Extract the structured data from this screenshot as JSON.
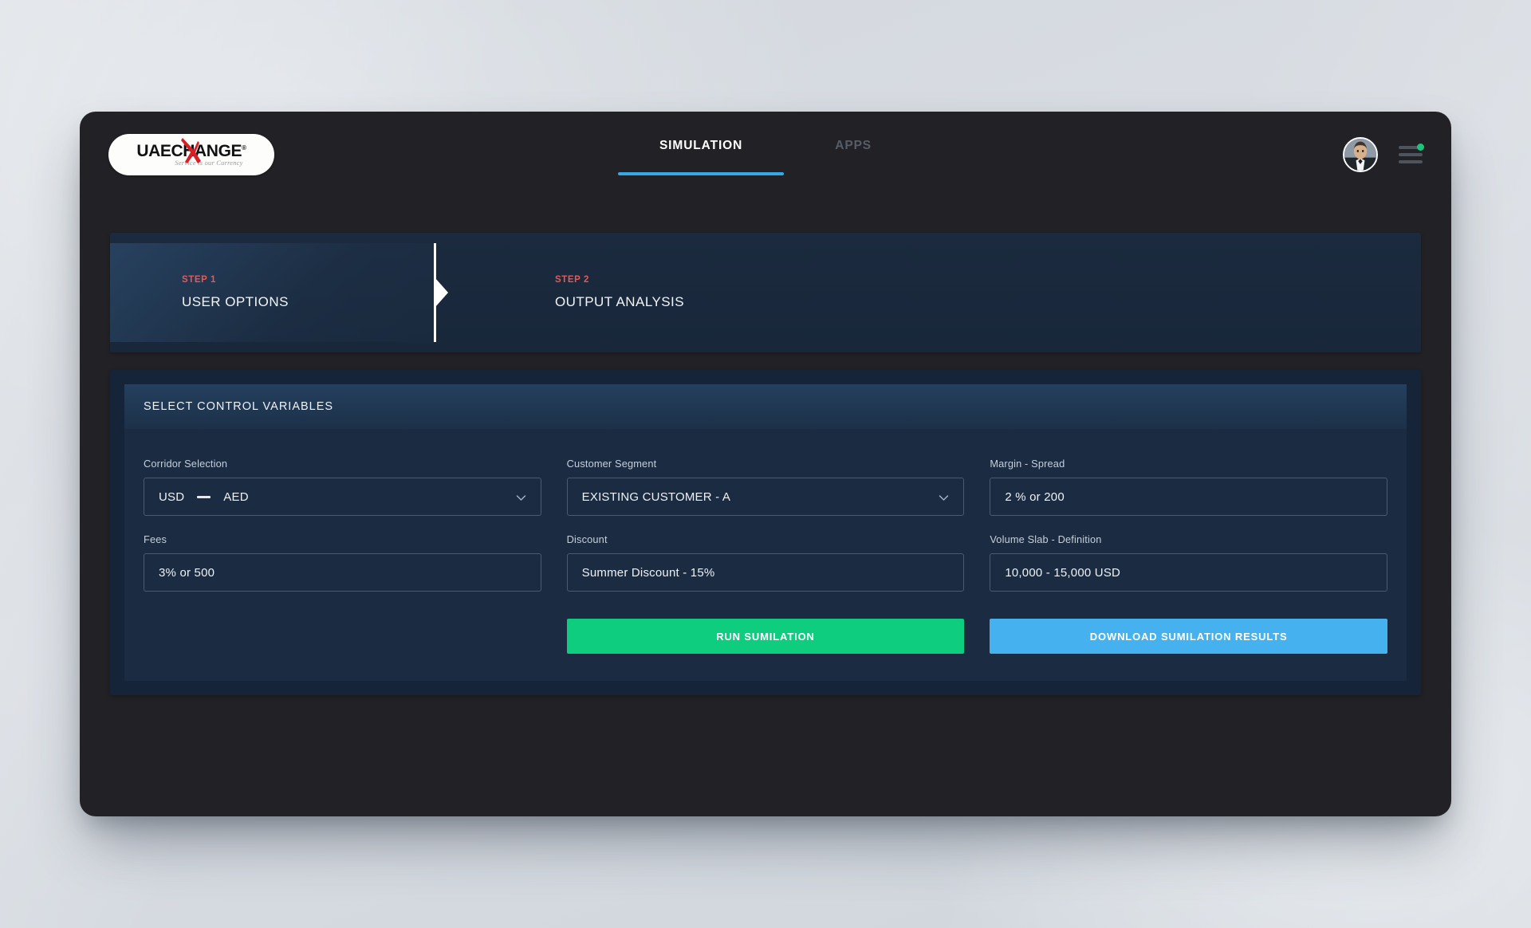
{
  "brand": {
    "name": "UAEXCHANGE",
    "name_before_x": "UAE",
    "name_after_x": "CHANGE",
    "registered_mark": "®",
    "tagline": "Service is our Currency",
    "x_color": "#d81f26"
  },
  "header": {
    "tabs": [
      {
        "label": "SIMULATION",
        "active": true
      },
      {
        "label": "APPS",
        "active": false
      }
    ],
    "avatar_name": "user-avatar",
    "menu_name": "hamburger-menu",
    "notification_dot_color": "#1bc47d",
    "active_tab_underline_color": "#35a9e8"
  },
  "stepper": {
    "steps": [
      {
        "kicker": "STEP 1",
        "title": "USER OPTIONS",
        "active": true
      },
      {
        "kicker": "STEP 2",
        "title": "OUTPUT ANALYSIS",
        "active": false
      }
    ],
    "kicker_color": "#e05a5a"
  },
  "form": {
    "section_title": "SELECT CONTROL VARIABLES",
    "fields": [
      {
        "label": "Corridor Selection",
        "type": "select",
        "value": "USD — AED",
        "from_currency": "USD",
        "to_currency": "AED"
      },
      {
        "label": "Customer Segment",
        "type": "select",
        "value": "EXISTING CUSTOMER - A"
      },
      {
        "label": "Margin - Spread",
        "type": "text",
        "value": "2 % or 200"
      },
      {
        "label": "Fees",
        "type": "text",
        "value": "3% or 500"
      },
      {
        "label": "Discount",
        "type": "text",
        "value": "Summer Discount - 15%"
      },
      {
        "label": "Volume Slab - Definition",
        "type": "text",
        "value": "10,000 - 15,000 USD"
      }
    ],
    "buttons": {
      "run": {
        "label": "RUN SUMILATION",
        "color": "#0ecd7f"
      },
      "download": {
        "label": "DOWNLOAD SUMILATION RESULTS",
        "color": "#45b2ef"
      }
    }
  }
}
